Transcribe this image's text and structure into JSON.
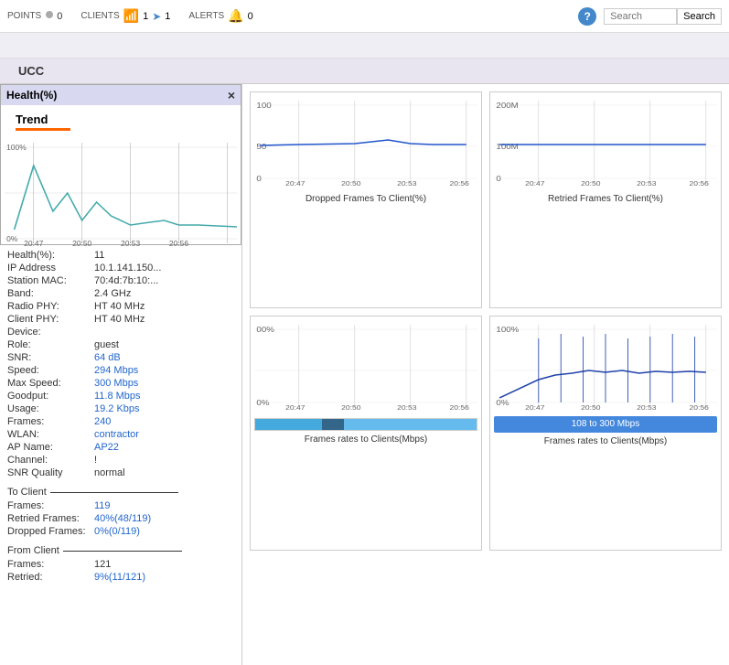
{
  "topbar": {
    "points_label": "POINTS",
    "points_value": "0",
    "clients_label": "CLIENTS",
    "clients_value1": "1",
    "clients_value2": "1",
    "alerts_label": "ALERTS",
    "alerts_value": "0",
    "search_placeholder": "Search",
    "search_button_label": "Search"
  },
  "ucc": {
    "label": "UCC"
  },
  "health_popup": {
    "title": "Health(%)",
    "trend_label": "Trend",
    "close_label": "×",
    "y_max": "100%",
    "y_min": "0%",
    "x_labels": [
      "20:47",
      "20:50",
      "20:53",
      "20:56"
    ]
  },
  "info": {
    "rows": [
      {
        "label": "Health(%):",
        "value": "11",
        "blue": false
      },
      {
        "label": "IP Address",
        "value": "10.1.141.150...",
        "blue": false
      },
      {
        "label": "Station MAC:",
        "value": "70:4d:7b:10:...",
        "blue": false
      },
      {
        "label": "Band:",
        "value": "2.4 GHz",
        "blue": false
      },
      {
        "label": "Radio PHY:",
        "value": "HT 40 MHz",
        "blue": false
      },
      {
        "label": "Client PHY:",
        "value": "HT 40 MHz",
        "blue": false
      },
      {
        "label": "Device:",
        "value": "",
        "blue": false
      },
      {
        "label": "Role:",
        "value": "guest",
        "blue": false
      },
      {
        "label": "SNR:",
        "value": "64 dB",
        "blue": true
      },
      {
        "label": "Speed:",
        "value": "294 Mbps",
        "blue": true
      },
      {
        "label": "Max Speed:",
        "value": "300 Mbps",
        "blue": true
      },
      {
        "label": "Goodput:",
        "value": "11.8 Mbps",
        "blue": true
      },
      {
        "label": "Usage:",
        "value": "19.2 Kbps",
        "blue": true
      },
      {
        "label": "Frames:",
        "value": "240",
        "blue": true
      },
      {
        "label": "WLAN:",
        "value": "contractor",
        "blue": true
      },
      {
        "label": "AP Name:",
        "value": "AP22",
        "blue": true
      },
      {
        "label": "Channel:",
        "value": "!",
        "blue": false
      },
      {
        "label": "SNR Quality",
        "value": "normal",
        "blue": false
      }
    ],
    "to_client_section": {
      "label": "To Client",
      "rows": [
        {
          "label": "Frames:",
          "value": "119",
          "blue": true
        },
        {
          "label": "Retried Frames:",
          "value": "40%(48/119)",
          "blue": true
        },
        {
          "label": "Dropped Frames:",
          "value": "0%(0/119)",
          "blue": true
        }
      ]
    },
    "from_client_section": {
      "label": "From Client",
      "rows": [
        {
          "label": "Frames:",
          "value": "121",
          "blue": false
        },
        {
          "label": "Retried:",
          "value": "9%(11/121)",
          "blue": true
        }
      ]
    }
  },
  "charts": {
    "dropped_frames": {
      "title": "Dropped Frames To Client(%)",
      "y_top": "100",
      "y_mid": "50",
      "y_bot": "0",
      "x_labels": [
        "20:47",
        "20:50",
        "20:53",
        "20:56"
      ]
    },
    "retried_frames": {
      "title": "Retried Frames To Client(%)",
      "y_top": "200M",
      "y_mid": "100M",
      "y_bot": "0",
      "x_labels": [
        "20:47",
        "20:50",
        "20:53",
        "20:56"
      ]
    },
    "frames_rates_client_bottom_left": {
      "title": "Frames rates to Clients(Mbps)",
      "y_top": "00%",
      "y_bot": "0%",
      "x_labels": [
        "20:47",
        "20:50",
        "20:53",
        "20:56"
      ],
      "bar_label": ""
    },
    "frames_rates_client_bottom_right": {
      "title": "Frames rates to Clients(Mbps)",
      "y_top": "100%",
      "y_bot": "0%",
      "x_labels": [
        "20:47",
        "20:50",
        "20:53",
        "20:56"
      ],
      "bar_label": "108 to 300 Mbps"
    }
  }
}
